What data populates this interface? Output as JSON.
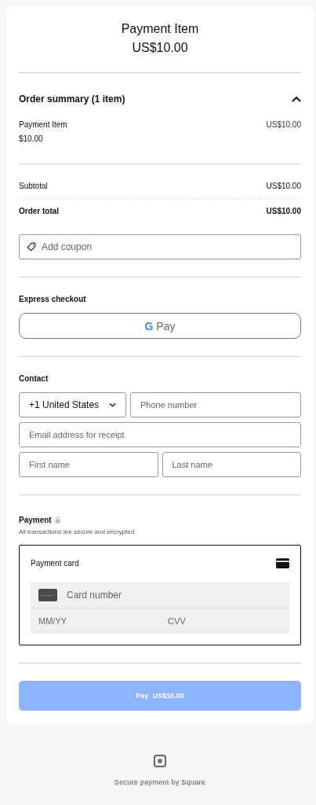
{
  "header": {
    "title": "Payment Item",
    "price": "US$10.00"
  },
  "order_summary": {
    "title": "Order summary (1 item)",
    "expanded": true,
    "items": [
      {
        "name": "Payment Item",
        "unit_price": "$10.00",
        "amount": "US$10.00"
      }
    ],
    "subtotal": {
      "label": "Subtotal",
      "value": "US$10.00"
    },
    "total": {
      "label": "Order total",
      "value": "US$10.00"
    },
    "coupon": {
      "placeholder": "Add coupon"
    }
  },
  "express_checkout": {
    "title": "Express checkout",
    "button": {
      "logo": "G",
      "label": "Pay"
    }
  },
  "contact": {
    "title": "Contact",
    "country": "+1 United States",
    "phone": {
      "placeholder": "Phone number"
    },
    "email": {
      "placeholder": "Email address for receipt"
    },
    "first_name": {
      "placeholder": "First name"
    },
    "last_name": {
      "placeholder": "Last name"
    }
  },
  "payment": {
    "title": "Payment",
    "subtitle": "All transactions are secure and encrypted",
    "method": "Payment card",
    "card_number": {
      "placeholder": "Card number"
    },
    "expiry": {
      "placeholder": "MM/YY"
    },
    "cvv": {
      "placeholder": "CVV"
    }
  },
  "pay_button": {
    "label": "Pay",
    "amount": "US$10.00",
    "disabled": true
  },
  "footer": {
    "text": "Secure payment by Square"
  }
}
